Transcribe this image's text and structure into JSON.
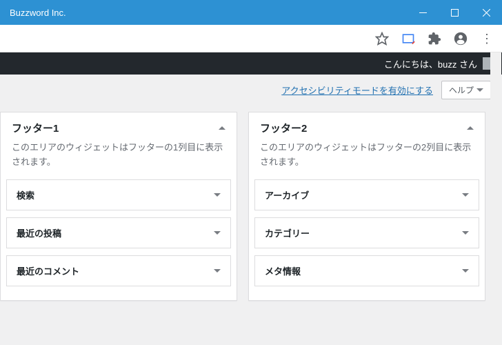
{
  "window": {
    "title": "Buzzword Inc."
  },
  "adminbar": {
    "greeting": "こんにちは、buzz さん"
  },
  "subheader": {
    "accessibility_link": "アクセシビリティモードを有効にする",
    "help_label": "ヘルプ"
  },
  "footer1": {
    "title": "フッター1",
    "description_partial": "このエリアのウィジェットはフッターの1列目に表示されます。",
    "widgets": [
      {
        "label": "検索"
      },
      {
        "label": "最近の投稿"
      },
      {
        "label": "最近のコメント"
      }
    ]
  },
  "footer2": {
    "title": "フッター2",
    "description": "このエリアのウィジェットはフッターの2列目に表示されます。",
    "widgets": [
      {
        "label": "アーカイブ"
      },
      {
        "label": "カテゴリー"
      },
      {
        "label": "メタ情報"
      }
    ]
  }
}
